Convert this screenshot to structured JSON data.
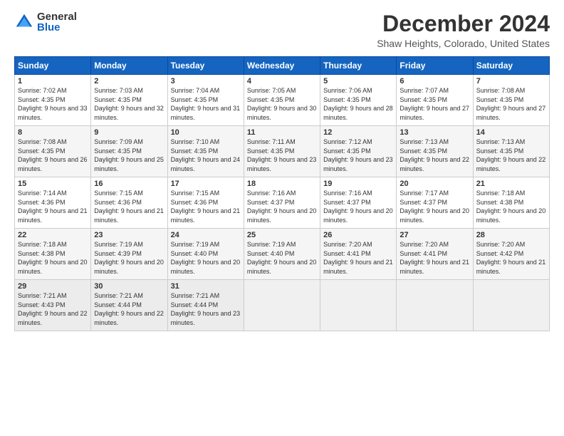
{
  "logo": {
    "general": "General",
    "blue": "Blue"
  },
  "header": {
    "title": "December 2024",
    "subtitle": "Shaw Heights, Colorado, United States"
  },
  "columns": [
    "Sunday",
    "Monday",
    "Tuesday",
    "Wednesday",
    "Thursday",
    "Friday",
    "Saturday"
  ],
  "weeks": [
    [
      {
        "num": "1",
        "sunrise": "7:02 AM",
        "sunset": "4:35 PM",
        "daylight": "9 hours and 33 minutes."
      },
      {
        "num": "2",
        "sunrise": "7:03 AM",
        "sunset": "4:35 PM",
        "daylight": "9 hours and 32 minutes."
      },
      {
        "num": "3",
        "sunrise": "7:04 AM",
        "sunset": "4:35 PM",
        "daylight": "9 hours and 31 minutes."
      },
      {
        "num": "4",
        "sunrise": "7:05 AM",
        "sunset": "4:35 PM",
        "daylight": "9 hours and 30 minutes."
      },
      {
        "num": "5",
        "sunrise": "7:06 AM",
        "sunset": "4:35 PM",
        "daylight": "9 hours and 28 minutes."
      },
      {
        "num": "6",
        "sunrise": "7:07 AM",
        "sunset": "4:35 PM",
        "daylight": "9 hours and 27 minutes."
      },
      {
        "num": "7",
        "sunrise": "7:08 AM",
        "sunset": "4:35 PM",
        "daylight": "9 hours and 27 minutes."
      }
    ],
    [
      {
        "num": "8",
        "sunrise": "7:08 AM",
        "sunset": "4:35 PM",
        "daylight": "9 hours and 26 minutes."
      },
      {
        "num": "9",
        "sunrise": "7:09 AM",
        "sunset": "4:35 PM",
        "daylight": "9 hours and 25 minutes."
      },
      {
        "num": "10",
        "sunrise": "7:10 AM",
        "sunset": "4:35 PM",
        "daylight": "9 hours and 24 minutes."
      },
      {
        "num": "11",
        "sunrise": "7:11 AM",
        "sunset": "4:35 PM",
        "daylight": "9 hours and 23 minutes."
      },
      {
        "num": "12",
        "sunrise": "7:12 AM",
        "sunset": "4:35 PM",
        "daylight": "9 hours and 23 minutes."
      },
      {
        "num": "13",
        "sunrise": "7:13 AM",
        "sunset": "4:35 PM",
        "daylight": "9 hours and 22 minutes."
      },
      {
        "num": "14",
        "sunrise": "7:13 AM",
        "sunset": "4:35 PM",
        "daylight": "9 hours and 22 minutes."
      }
    ],
    [
      {
        "num": "15",
        "sunrise": "7:14 AM",
        "sunset": "4:36 PM",
        "daylight": "9 hours and 21 minutes."
      },
      {
        "num": "16",
        "sunrise": "7:15 AM",
        "sunset": "4:36 PM",
        "daylight": "9 hours and 21 minutes."
      },
      {
        "num": "17",
        "sunrise": "7:15 AM",
        "sunset": "4:36 PM",
        "daylight": "9 hours and 21 minutes."
      },
      {
        "num": "18",
        "sunrise": "7:16 AM",
        "sunset": "4:37 PM",
        "daylight": "9 hours and 20 minutes."
      },
      {
        "num": "19",
        "sunrise": "7:16 AM",
        "sunset": "4:37 PM",
        "daylight": "9 hours and 20 minutes."
      },
      {
        "num": "20",
        "sunrise": "7:17 AM",
        "sunset": "4:37 PM",
        "daylight": "9 hours and 20 minutes."
      },
      {
        "num": "21",
        "sunrise": "7:18 AM",
        "sunset": "4:38 PM",
        "daylight": "9 hours and 20 minutes."
      }
    ],
    [
      {
        "num": "22",
        "sunrise": "7:18 AM",
        "sunset": "4:38 PM",
        "daylight": "9 hours and 20 minutes."
      },
      {
        "num": "23",
        "sunrise": "7:19 AM",
        "sunset": "4:39 PM",
        "daylight": "9 hours and 20 minutes."
      },
      {
        "num": "24",
        "sunrise": "7:19 AM",
        "sunset": "4:40 PM",
        "daylight": "9 hours and 20 minutes."
      },
      {
        "num": "25",
        "sunrise": "7:19 AM",
        "sunset": "4:40 PM",
        "daylight": "9 hours and 20 minutes."
      },
      {
        "num": "26",
        "sunrise": "7:20 AM",
        "sunset": "4:41 PM",
        "daylight": "9 hours and 21 minutes."
      },
      {
        "num": "27",
        "sunrise": "7:20 AM",
        "sunset": "4:41 PM",
        "daylight": "9 hours and 21 minutes."
      },
      {
        "num": "28",
        "sunrise": "7:20 AM",
        "sunset": "4:42 PM",
        "daylight": "9 hours and 21 minutes."
      }
    ],
    [
      {
        "num": "29",
        "sunrise": "7:21 AM",
        "sunset": "4:43 PM",
        "daylight": "9 hours and 22 minutes."
      },
      {
        "num": "30",
        "sunrise": "7:21 AM",
        "sunset": "4:44 PM",
        "daylight": "9 hours and 22 minutes."
      },
      {
        "num": "31",
        "sunrise": "7:21 AM",
        "sunset": "4:44 PM",
        "daylight": "9 hours and 23 minutes."
      },
      null,
      null,
      null,
      null
    ]
  ]
}
